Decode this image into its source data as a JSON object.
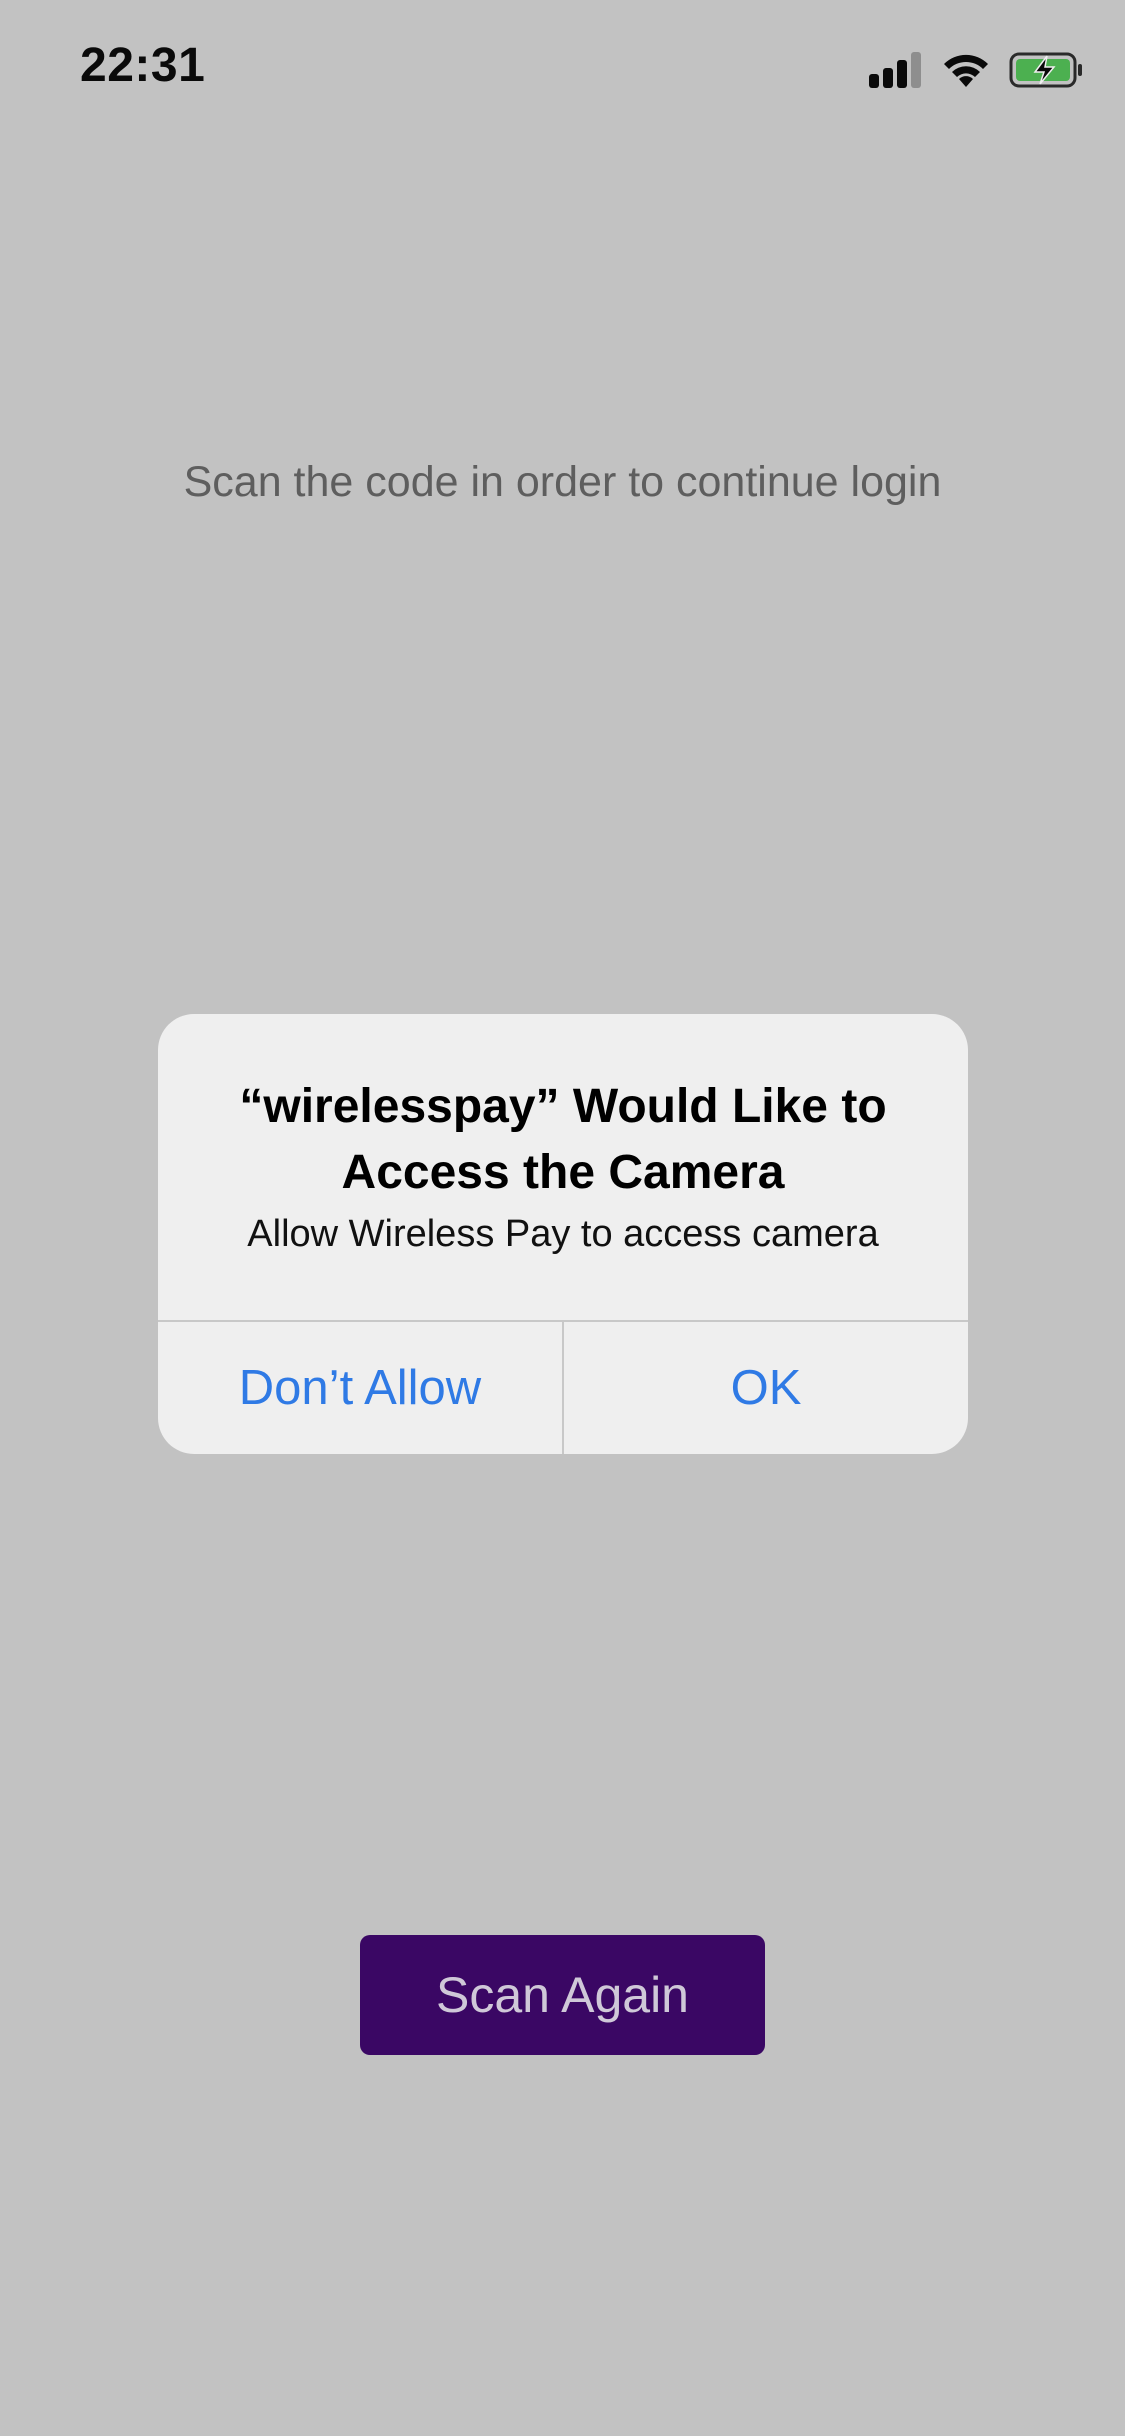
{
  "status_bar": {
    "time": "22:31",
    "icons": [
      "cellular-signal-icon",
      "wifi-icon",
      "battery-charging-icon"
    ],
    "battery_color": "#4cb050"
  },
  "main": {
    "instruction": "Scan the code in order to continue login",
    "scan_again_label": "Scan Again",
    "button_color": "#3a0764"
  },
  "alert": {
    "title": "“wirelesspay” Would Like to Access the Camera",
    "message": "Allow Wireless Pay to access camera",
    "deny_label": "Don’t Allow",
    "ok_label": "OK",
    "button_text_color": "#2f7ae5"
  }
}
